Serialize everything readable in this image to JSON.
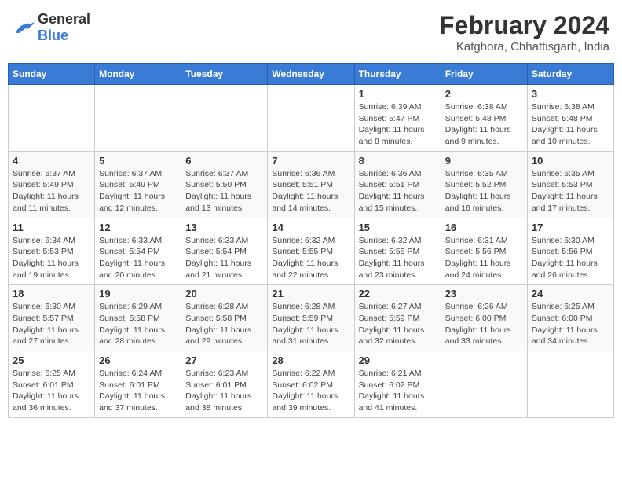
{
  "header": {
    "logo_general": "General",
    "logo_blue": "Blue",
    "month_year": "February 2024",
    "location": "Katghora, Chhattisgarh, India"
  },
  "days_of_week": [
    "Sunday",
    "Monday",
    "Tuesday",
    "Wednesday",
    "Thursday",
    "Friday",
    "Saturday"
  ],
  "weeks": [
    [
      {
        "day": null,
        "info": null
      },
      {
        "day": null,
        "info": null
      },
      {
        "day": null,
        "info": null
      },
      {
        "day": null,
        "info": null
      },
      {
        "day": "1",
        "info": "Sunrise: 6:39 AM\nSunset: 5:47 PM\nDaylight: 11 hours and 8 minutes."
      },
      {
        "day": "2",
        "info": "Sunrise: 6:38 AM\nSunset: 5:48 PM\nDaylight: 11 hours and 9 minutes."
      },
      {
        "day": "3",
        "info": "Sunrise: 6:38 AM\nSunset: 5:48 PM\nDaylight: 11 hours and 10 minutes."
      }
    ],
    [
      {
        "day": "4",
        "info": "Sunrise: 6:37 AM\nSunset: 5:49 PM\nDaylight: 11 hours and 11 minutes."
      },
      {
        "day": "5",
        "info": "Sunrise: 6:37 AM\nSunset: 5:49 PM\nDaylight: 11 hours and 12 minutes."
      },
      {
        "day": "6",
        "info": "Sunrise: 6:37 AM\nSunset: 5:50 PM\nDaylight: 11 hours and 13 minutes."
      },
      {
        "day": "7",
        "info": "Sunrise: 6:36 AM\nSunset: 5:51 PM\nDaylight: 11 hours and 14 minutes."
      },
      {
        "day": "8",
        "info": "Sunrise: 6:36 AM\nSunset: 5:51 PM\nDaylight: 11 hours and 15 minutes."
      },
      {
        "day": "9",
        "info": "Sunrise: 6:35 AM\nSunset: 5:52 PM\nDaylight: 11 hours and 16 minutes."
      },
      {
        "day": "10",
        "info": "Sunrise: 6:35 AM\nSunset: 5:53 PM\nDaylight: 11 hours and 17 minutes."
      }
    ],
    [
      {
        "day": "11",
        "info": "Sunrise: 6:34 AM\nSunset: 5:53 PM\nDaylight: 11 hours and 19 minutes."
      },
      {
        "day": "12",
        "info": "Sunrise: 6:33 AM\nSunset: 5:54 PM\nDaylight: 11 hours and 20 minutes."
      },
      {
        "day": "13",
        "info": "Sunrise: 6:33 AM\nSunset: 5:54 PM\nDaylight: 11 hours and 21 minutes."
      },
      {
        "day": "14",
        "info": "Sunrise: 6:32 AM\nSunset: 5:55 PM\nDaylight: 11 hours and 22 minutes."
      },
      {
        "day": "15",
        "info": "Sunrise: 6:32 AM\nSunset: 5:55 PM\nDaylight: 11 hours and 23 minutes."
      },
      {
        "day": "16",
        "info": "Sunrise: 6:31 AM\nSunset: 5:56 PM\nDaylight: 11 hours and 24 minutes."
      },
      {
        "day": "17",
        "info": "Sunrise: 6:30 AM\nSunset: 5:56 PM\nDaylight: 11 hours and 26 minutes."
      }
    ],
    [
      {
        "day": "18",
        "info": "Sunrise: 6:30 AM\nSunset: 5:57 PM\nDaylight: 11 hours and 27 minutes."
      },
      {
        "day": "19",
        "info": "Sunrise: 6:29 AM\nSunset: 5:58 PM\nDaylight: 11 hours and 28 minutes."
      },
      {
        "day": "20",
        "info": "Sunrise: 6:28 AM\nSunset: 5:58 PM\nDaylight: 11 hours and 29 minutes."
      },
      {
        "day": "21",
        "info": "Sunrise: 6:28 AM\nSunset: 5:59 PM\nDaylight: 11 hours and 31 minutes."
      },
      {
        "day": "22",
        "info": "Sunrise: 6:27 AM\nSunset: 5:59 PM\nDaylight: 11 hours and 32 minutes."
      },
      {
        "day": "23",
        "info": "Sunrise: 6:26 AM\nSunset: 6:00 PM\nDaylight: 11 hours and 33 minutes."
      },
      {
        "day": "24",
        "info": "Sunrise: 6:25 AM\nSunset: 6:00 PM\nDaylight: 11 hours and 34 minutes."
      }
    ],
    [
      {
        "day": "25",
        "info": "Sunrise: 6:25 AM\nSunset: 6:01 PM\nDaylight: 11 hours and 36 minutes."
      },
      {
        "day": "26",
        "info": "Sunrise: 6:24 AM\nSunset: 6:01 PM\nDaylight: 11 hours and 37 minutes."
      },
      {
        "day": "27",
        "info": "Sunrise: 6:23 AM\nSunset: 6:01 PM\nDaylight: 11 hours and 38 minutes."
      },
      {
        "day": "28",
        "info": "Sunrise: 6:22 AM\nSunset: 6:02 PM\nDaylight: 11 hours and 39 minutes."
      },
      {
        "day": "29",
        "info": "Sunrise: 6:21 AM\nSunset: 6:02 PM\nDaylight: 11 hours and 41 minutes."
      },
      {
        "day": null,
        "info": null
      },
      {
        "day": null,
        "info": null
      }
    ]
  ]
}
